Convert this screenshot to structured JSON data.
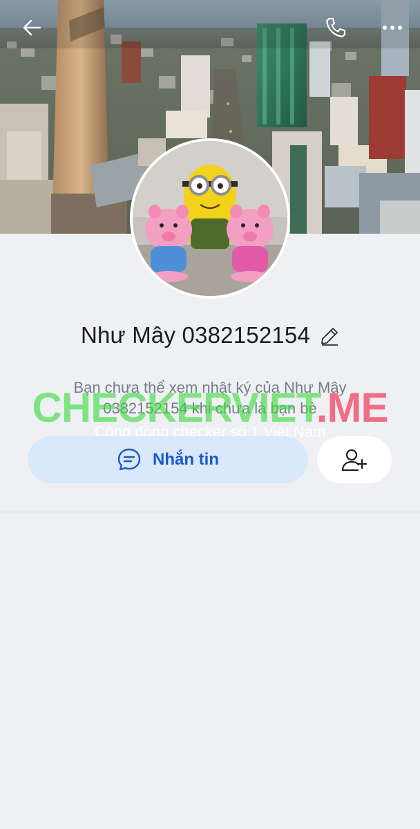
{
  "profile": {
    "name": "Như Mây 0382152154",
    "notice": "Bạn chưa thể xem nhật ký của Như Mây 0382152154 khi chưa là bạn bè"
  },
  "actions": {
    "message_label": "Nhắn tin"
  },
  "watermark": {
    "part_a": "CHECKERVIET",
    "part_b": ".ME",
    "tagline": "Cộng đồng checker số 1 Việt Nam"
  },
  "icons": {
    "back": "arrow-left-icon",
    "call": "phone-icon",
    "more": "more-horizontal-icon",
    "edit": "pencil-icon",
    "chat": "chat-bubble-icon",
    "add_friend": "user-plus-icon"
  },
  "colors": {
    "accent": "#1a57c9",
    "message_button_bg": "#d9e8fb",
    "background": "#eef0f4"
  }
}
